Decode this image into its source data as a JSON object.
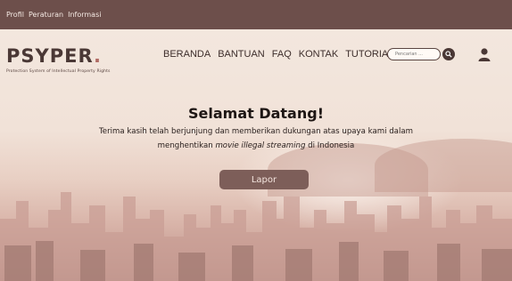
{
  "topbar": {
    "links": [
      "Profil",
      "Peraturan",
      "Informasi"
    ]
  },
  "brand": {
    "logo_text": "PSYPER",
    "logo_dot": ".",
    "tagline": "Protection System of Intellectual Property Rights"
  },
  "nav": {
    "items": [
      "BERANDA",
      "BANTUAN",
      "FAQ",
      "KONTAK",
      "TUTORIAL"
    ]
  },
  "search": {
    "placeholder": "Pencarian ..."
  },
  "hero": {
    "title": "Selamat Datang!",
    "line1": "Terima kasih telah berjunjung dan memberikan dukungan atas upaya kami dalam",
    "line2_pre": "menghentikan ",
    "line2_em": "movie illegal streaming",
    "line2_post": " di Indonesia",
    "button": "Lapor"
  },
  "colors": {
    "topbar": "#6d4f4b",
    "button": "#7d5e59",
    "logo": "#4a3835"
  },
  "icons": {
    "search": "search-icon",
    "user": "user-icon"
  }
}
